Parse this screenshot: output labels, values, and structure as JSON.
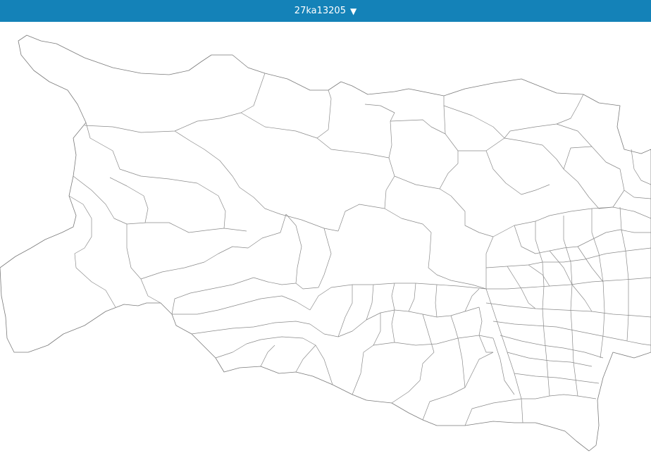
{
  "header": {
    "title": "27ka13205",
    "dropdown_icon": "caret-down-icon"
  },
  "colors": {
    "header_background": "#1482b8",
    "header_text": "#ffffff",
    "boundary_stroke": "#7a7a7a",
    "region_fill": "#ffffff"
  }
}
